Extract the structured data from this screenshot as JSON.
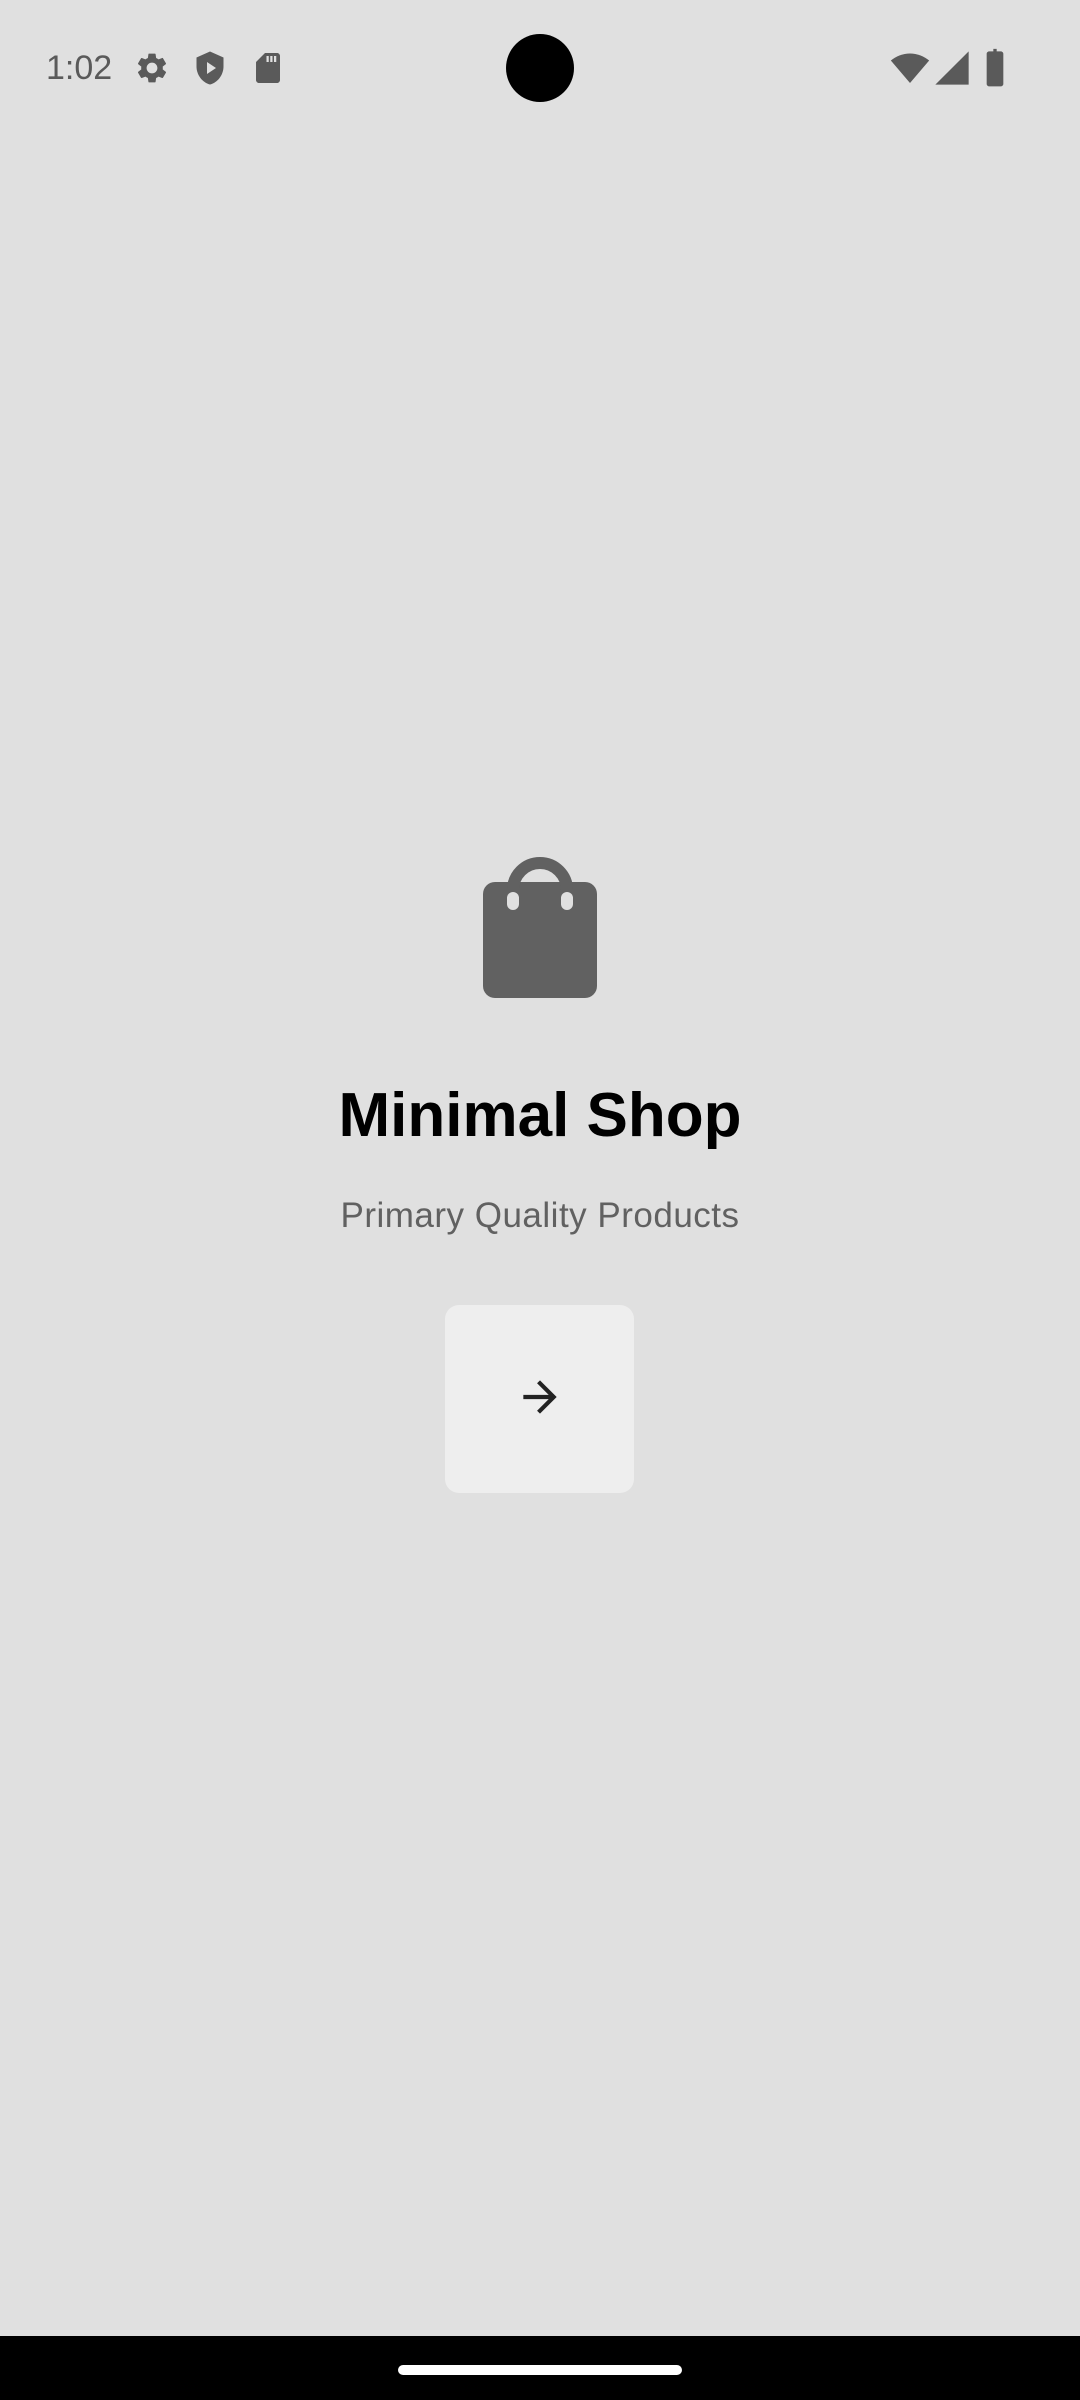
{
  "status_bar": {
    "time": "1:02",
    "left_icons": [
      "gear-icon",
      "shield-icon",
      "sd-card-icon"
    ],
    "right_icons": [
      "wifi-icon",
      "signal-icon",
      "battery-icon"
    ]
  },
  "app": {
    "logo_icon": "shopping-bag-icon",
    "title": "Minimal Shop",
    "subtitle": "Primary Quality Products",
    "next_button_icon": "arrow-right-icon"
  },
  "colors": {
    "background": "#e0e0e0",
    "icon": "#616161",
    "button_background": "#eeeeee",
    "title": "#000000",
    "subtitle": "#616161"
  }
}
